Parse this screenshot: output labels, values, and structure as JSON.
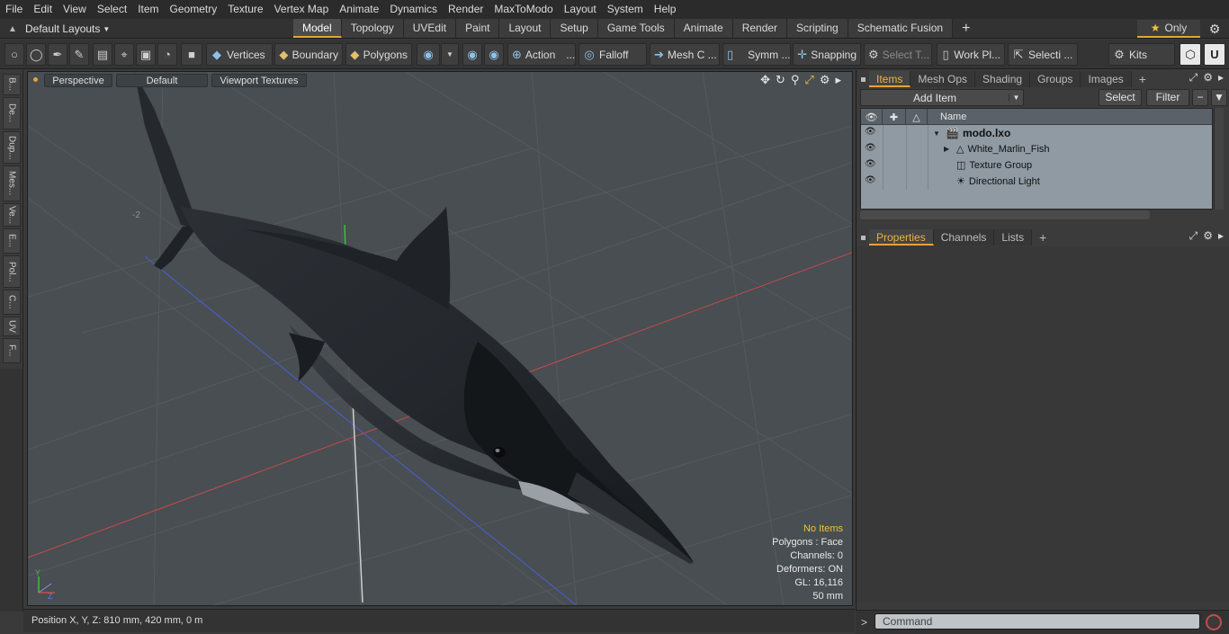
{
  "menu": [
    "File",
    "Edit",
    "View",
    "Select",
    "Item",
    "Geometry",
    "Texture",
    "Vertex Map",
    "Animate",
    "Dynamics",
    "Render",
    "MaxToModo",
    "Layout",
    "System",
    "Help"
  ],
  "layout_selector": "Default Layouts",
  "tabs": [
    "Model",
    "Topology",
    "UVEdit",
    "Paint",
    "Layout",
    "Setup",
    "Game Tools",
    "Animate",
    "Render",
    "Scripting",
    "Schematic Fusion"
  ],
  "active_tab": "Model",
  "only_label": "Only",
  "toolbar": {
    "vertices": "Vertices",
    "boundary": "Boundary",
    "polygons": "Polygons",
    "action": "Action",
    "falloff": "Falloff",
    "mesh_c": "Mesh C ...",
    "symm": "Symm ...",
    "snapping": "Snapping",
    "select_t": "Select T...",
    "work_pl": "Work Pl...",
    "selecti": "Selecti ...",
    "kits": "Kits",
    "dots": "..."
  },
  "left_tabs": [
    "B...",
    "De...",
    "Dup...",
    "Mes...",
    "Ve...",
    "E...",
    "Pol...",
    "C...",
    "UV",
    "F..."
  ],
  "viewport": {
    "perspective": "Perspective",
    "default": "Default",
    "textures": "Viewport Textures",
    "stats": {
      "selection": "No Items",
      "polygons": "Polygons : Face",
      "channels": "Channels: 0",
      "deformers": "Deformers: ON",
      "gl": "GL: 16,116",
      "scale": "50 mm"
    },
    "axis_labels": {
      "y": "Y",
      "z": "Z"
    },
    "grid_marker": "-2"
  },
  "status": {
    "position": "Position X, Y, Z:  810 mm, 420 mm, 0 m"
  },
  "items_panel": {
    "tabs": [
      "Items",
      "Mesh Ops",
      "Shading",
      "Groups",
      "Images"
    ],
    "active": "Items",
    "add_item": "Add Item",
    "select": "Select",
    "filter": "Filter",
    "column_name": "Name",
    "tree": [
      {
        "name": "modo.lxo",
        "bold": true,
        "expand": "▼",
        "indent": 0
      },
      {
        "name": "White_Marlin_Fish",
        "bold": false,
        "expand": "▶",
        "indent": 1
      },
      {
        "name": "Texture Group",
        "bold": false,
        "expand": "",
        "indent": 1
      },
      {
        "name": "Directional Light",
        "bold": false,
        "expand": "",
        "indent": 1
      }
    ]
  },
  "properties_panel": {
    "tabs": [
      "Properties",
      "Channels",
      "Lists"
    ],
    "active": "Properties"
  },
  "command": {
    "placeholder": "Command"
  },
  "colors": {
    "accent": "#e8a23a",
    "highlight_text": "#f0c040",
    "viewport_bg": "#484e52",
    "x_axis": "#c84a4a",
    "y_axis": "#3fbf3f",
    "z_axis": "#4a5fd0"
  }
}
